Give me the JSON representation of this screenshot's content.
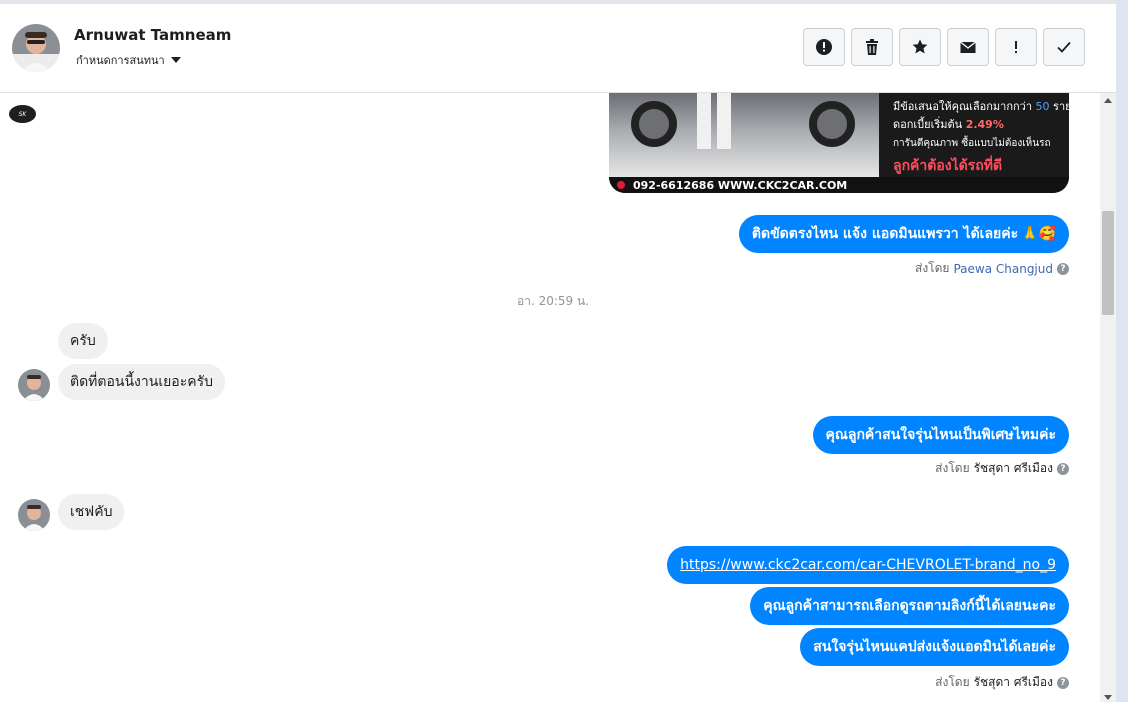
{
  "header": {
    "contact_name": "Arnuwat Tamneam",
    "subtitle": "กำหนดการสนทนา",
    "actions": [
      {
        "name": "report-button",
        "icon": "alert-circle-icon"
      },
      {
        "name": "delete-button",
        "icon": "trash-icon"
      },
      {
        "name": "star-button",
        "icon": "star-icon"
      },
      {
        "name": "mark-unread-button",
        "icon": "envelope-icon"
      },
      {
        "name": "important-button",
        "icon": "exclamation-icon"
      },
      {
        "name": "done-button",
        "icon": "check-icon"
      }
    ]
  },
  "promo_image": {
    "line1_prefix": "มีข้อเสนอให้คุณเลือกมากกว่า",
    "line1_number": "50",
    "line1_suffix": "รายการ",
    "line2_prefix": "ดอกเบี้ยเริ่มต้น",
    "line2_rate": "2.49%",
    "line3": "การันตีคุณภาพ ซื้อแบบไม่ต้องเห็นรถ",
    "line4": "ลูกค้าต้องได้รถที่ดี",
    "footer": "092-6612686  WWW.CKC2CAR.COM"
  },
  "messages": {
    "out1": "ติดขัดตรงไหน แจ้ง แอดมินแพรวา ได้เลยค่ะ",
    "out1_emoji": "🙏🥰",
    "sent_by_label": "ส่งโดย",
    "sent_by_1": "Paewa Changjud",
    "timestamp": "อา. 20:59 น.",
    "in1": "ครับ",
    "in2": "ติดที่ตอนนี้งานเยอะครับ",
    "out2": "คุณลูกค้าสนใจรุ่นไหนเป็นพิเศษไหมค่ะ",
    "sent_by_2": "รัชสุดา ศรีเมือง",
    "in3": "เชฟคับ",
    "out3_link": "https://www.ckc2car.com/car-CHEVROLET-brand_no_9",
    "out4": "คุณลูกค้าสามารถเลือกดูรถตามลิงก์นี้ได้เลยนะคะ",
    "out5": "สนใจรุ่นไหนแคปส่งแจ้งแอดมินได้เลยค่ะ",
    "sent_by_3": "รัชสุดา ศรีเมือง"
  },
  "help_icon": "question-circle-icon",
  "colors": {
    "outgoing_bubble": "#0084ff",
    "incoming_bubble": "#f1f0f0",
    "sender_link": "#4267b2"
  }
}
